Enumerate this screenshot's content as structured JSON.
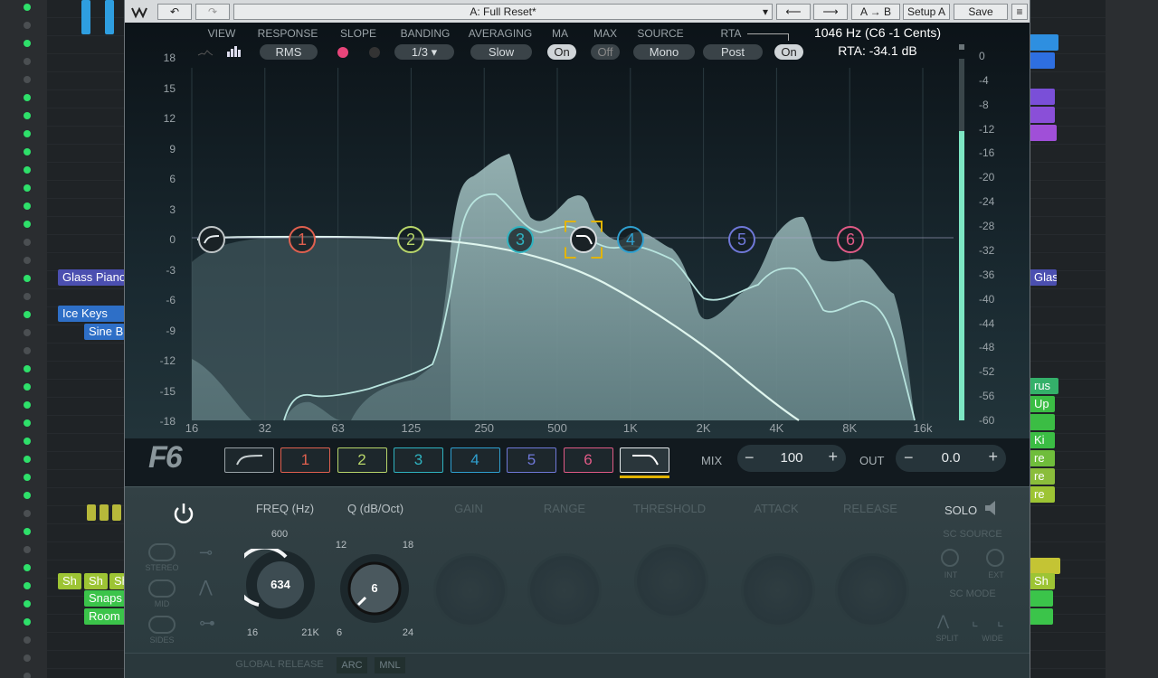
{
  "topbar": {
    "undo": "↶",
    "redo": "↷",
    "preset": "A: Full Reset*",
    "left": "⟵",
    "right": "⟶",
    "ab": "A → B",
    "setup": "Setup A",
    "save": "Save"
  },
  "header": {
    "view": "VIEW",
    "response": "RESPONSE",
    "response_val": "RMS",
    "slope": "SLOPE",
    "banding": "BANDING",
    "banding_val": "1/3",
    "averaging": "AVERAGING",
    "averaging_val": "Slow",
    "ma": "MA",
    "ma_val": "On",
    "max": "MAX",
    "max_val": "Off",
    "source": "SOURCE",
    "source_val": "Mono",
    "rta": "RTA",
    "rta_val": "Post",
    "rta_on": "On",
    "readout_freq": "1046 Hz (C6 -1 Cents)",
    "readout_rta": "RTA: -34.1 dB"
  },
  "y_left": [
    "18",
    "15",
    "12",
    "9",
    "6",
    "3",
    "0",
    "-3",
    "-6",
    "-9",
    "-12",
    "-15",
    "-18"
  ],
  "y_right": [
    "0",
    "-4",
    "-8",
    "-12",
    "-16",
    "-20",
    "-24",
    "-28",
    "-32",
    "-36",
    "-40",
    "-44",
    "-48",
    "-52",
    "-56",
    "-60"
  ],
  "x_ticks": [
    "16",
    "32",
    "63",
    "125",
    "250",
    "500",
    "1K",
    "2K",
    "4K",
    "8K",
    "16k"
  ],
  "band_nodes": [
    "1",
    "2",
    "3",
    "4",
    "5",
    "6"
  ],
  "band_buttons": [
    "1",
    "2",
    "3",
    "4",
    "5",
    "6"
  ],
  "logo": "F6",
  "mix": {
    "label": "MIX",
    "value": "100",
    "minus": "−",
    "plus": "+"
  },
  "out": {
    "label": "OUT",
    "value": "0.0",
    "minus": "−",
    "plus": "+"
  },
  "lower": {
    "freq_label": "FREQ (Hz)",
    "q_label": "Q (dB/Oct)",
    "freq_value": "634",
    "q_value": "6",
    "freq_min": "16",
    "freq_max": "21K",
    "freq_top": "600",
    "q_min": "6",
    "q_max": "24",
    "q_top_l": "12",
    "q_top_r": "18",
    "gain": "GAIN",
    "range": "RANGE",
    "threshold": "THRESHOLD",
    "attack": "ATTACK",
    "release": "RELEASE",
    "solo": "SOLO",
    "sc_source": "SC SOURCE",
    "sc_mode": "SC MODE",
    "int": "INT",
    "ext": "EXT",
    "split": "SPLIT",
    "wide": "WIDE",
    "stereo": "STEREO",
    "mid": "MID",
    "sides": "SIDES",
    "global_release": "GLOBAL RELEASE",
    "arc": "ARC",
    "mnl": "MNL"
  },
  "clips": {
    "glass": "Glass Piano",
    "ice": "Ice Keys",
    "sine": "Sine B",
    "sh": "Sh",
    "snaps": "Snaps",
    "room": "Room",
    "glas_r": "Glas",
    "rus": "rus",
    "up": "Up",
    "ki": "Ki",
    "re": "re"
  }
}
